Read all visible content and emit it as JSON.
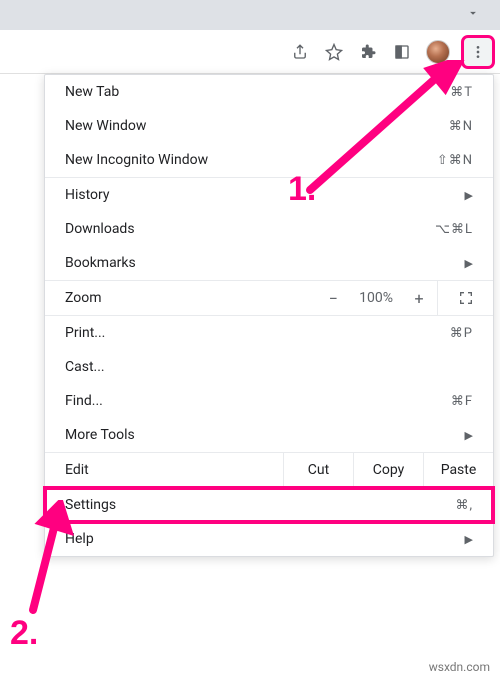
{
  "toolbar": {
    "share_icon": "share-icon",
    "star_icon": "star-icon",
    "extensions_icon": "puzzle-icon",
    "reading_icon": "reading-list-icon",
    "avatar": "profile-avatar",
    "more_icon": "more-vert-icon"
  },
  "menu": {
    "new_tab": {
      "label": "New Tab",
      "shortcut": "⌘T"
    },
    "new_window": {
      "label": "New Window",
      "shortcut": "⌘N"
    },
    "new_incognito": {
      "label": "New Incognito Window",
      "shortcut": "⇧⌘N"
    },
    "history": {
      "label": "History"
    },
    "downloads": {
      "label": "Downloads",
      "shortcut": "⌥⌘L"
    },
    "bookmarks": {
      "label": "Bookmarks"
    },
    "zoom": {
      "label": "Zoom",
      "minus": "−",
      "pct": "100%",
      "plus": "+"
    },
    "print": {
      "label": "Print...",
      "shortcut": "⌘P"
    },
    "cast": {
      "label": "Cast..."
    },
    "find": {
      "label": "Find...",
      "shortcut": "⌘F"
    },
    "more_tools": {
      "label": "More Tools"
    },
    "edit": {
      "label": "Edit",
      "cut": "Cut",
      "copy": "Copy",
      "paste": "Paste"
    },
    "settings": {
      "label": "Settings",
      "shortcut": "⌘,"
    },
    "help": {
      "label": "Help"
    }
  },
  "annotations": {
    "one": "1.",
    "two": "2."
  },
  "watermark": "wsxdn.com"
}
